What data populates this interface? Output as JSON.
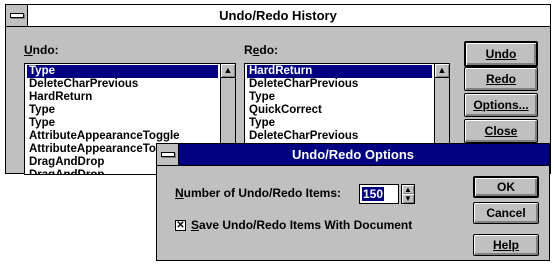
{
  "history": {
    "title": "Undo/Redo History",
    "undo_label": "Undo:",
    "redo_label": "Redo:",
    "undo_items": [
      "Type",
      "DeleteCharPrevious",
      "HardReturn",
      "Type",
      "Type",
      "AttributeAppearanceToggle",
      "AttributeAppearanceToggle",
      "DragAndDrop",
      "DragAndDrop"
    ],
    "undo_selected": "Type",
    "redo_items": [
      "HardReturn",
      "DeleteCharPrevious",
      "Type",
      "QuickCorrect",
      "Type",
      "DeleteCharPrevious"
    ],
    "redo_selected": "HardReturn",
    "buttons": {
      "undo": "Undo",
      "redo": "Redo",
      "options": "Options...",
      "close": "Close"
    }
  },
  "options": {
    "title": "Undo/Redo Options",
    "number_label": "Number of Undo/Redo Items:",
    "number_value": "150",
    "save_label": "Save Undo/Redo Items With Document",
    "save_checked": true,
    "buttons": {
      "ok": "OK",
      "cancel": "Cancel",
      "help": "Help"
    }
  },
  "icons": {
    "scroll_up": "▲",
    "scroll_down": "▼",
    "checkmark": "✕"
  },
  "colors": {
    "face": "#c0c0c0",
    "title_active": "#000080",
    "selection": "#000080"
  }
}
